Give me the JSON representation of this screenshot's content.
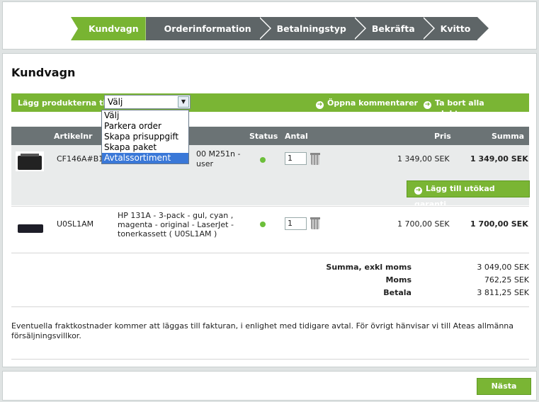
{
  "steps": [
    {
      "label": "Kundvagn",
      "active": true
    },
    {
      "label": "Orderinformation",
      "active": false
    },
    {
      "label": "Betalningstyp",
      "active": false
    },
    {
      "label": "Bekräfta",
      "active": false
    },
    {
      "label": "Kvitto",
      "active": false
    }
  ],
  "page_title": "Kundvagn",
  "toolbar": {
    "add_to_label": "Lägg produkterna till",
    "select_value": "Välj",
    "open_comments": "Öppna kommentarer",
    "remove_all": "Ta bort alla produkter"
  },
  "dropdown_options": [
    "Välj",
    "Parkera order",
    "Skapa prisuppgift",
    "Skapa paket",
    "Avtalssortiment"
  ],
  "dropdown_highlighted": "Avtalssortiment",
  "table": {
    "headers": {
      "artikelnr": "Artikelnr",
      "status": "Status",
      "antal": "Antal",
      "pris": "Pris",
      "summa": "Summa"
    },
    "rows": [
      {
        "artikelnr": "CF146A#B19",
        "description_partial": "00 M251n -",
        "description_partial2": "user",
        "qty": "1",
        "pris": "1 349,00 SEK",
        "summa": "1 349,00 SEK",
        "status_color": "#6cbf3a"
      },
      {
        "artikelnr": "U0SL1AM",
        "description_l1": "HP 131A - 3-pack - gul, cyan ,",
        "description_l2": "magenta - original - LaserJet -",
        "description_l3": "tonerkassett ( U0SL1AM )",
        "qty": "1",
        "pris": "1 700,00 SEK",
        "summa": "1 700,00 SEK",
        "status_color": "#6cbf3a"
      }
    ],
    "warranty_button": "Lägg till utökad garanti"
  },
  "totals": {
    "exkl_label": "Summa, exkl moms",
    "exkl_value": "3 049,00 SEK",
    "moms_label": "Moms",
    "moms_value": "762,25 SEK",
    "betala_label": "Betala",
    "betala_value": "3 811,25 SEK"
  },
  "note": "Eventuella fraktkostnader kommer att läggas till fakturan, i enlighet med tidigare avtal. För övrigt hänvisar vi till Ateas allmänna försäljningsvillkor.",
  "next_button": "Nästa",
  "colors": {
    "accent": "#7ab534",
    "step_inactive": "#5e6567",
    "table_header": "#6b7375"
  }
}
